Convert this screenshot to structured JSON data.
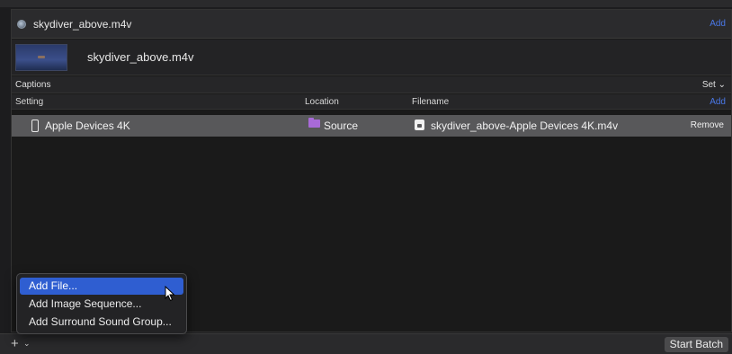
{
  "job": {
    "title": "skydiver_above.m4v",
    "add_label": "Add"
  },
  "clip": {
    "name": "skydiver_above.m4v"
  },
  "captions": {
    "label": "Captions",
    "set_label": "Set ⌄"
  },
  "table": {
    "headers": {
      "setting": "Setting",
      "location": "Location",
      "filename": "Filename",
      "add": "Add"
    },
    "rows": [
      {
        "setting": "Apple Devices 4K",
        "location": "Source",
        "filename": "skydiver_above-Apple Devices 4K.m4v",
        "action": "Remove"
      }
    ]
  },
  "add_menu": {
    "items": [
      "Add File...",
      "Add Image Sequence...",
      "Add Surround Sound Group..."
    ],
    "selected_index": 0
  },
  "bottom_bar": {
    "plus": "+",
    "chevron": "⌄",
    "start_batch": "Start Batch"
  },
  "colors": {
    "accent": "#2f5ed1",
    "link": "#4a78e8",
    "folder": "#a86ad8",
    "selected_row": "#58585a"
  },
  "icons": {
    "job": "job-icon",
    "device": "phone-icon",
    "location": "folder-icon",
    "file": "file-icon",
    "cursor": "pointer-cursor"
  }
}
